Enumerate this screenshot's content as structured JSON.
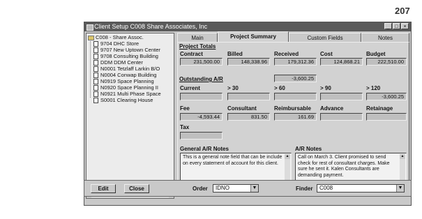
{
  "page_number": "207",
  "window": {
    "title": "Client Setup   C008   Share Associates, Inc",
    "controls": [
      "_",
      "□",
      "×"
    ]
  },
  "tree": {
    "root": "C008 - Share Assoc.",
    "items": [
      "9704  DHC Store",
      "9707  New Uptown Center",
      "9708  Consulting Building",
      "DDM  DDM Center",
      "N0001  Tetzlaff Larkin B/O",
      "N0004  Conwap Building",
      "N0919  Space Planning",
      "N0920  Space Planning II",
      "N0921  Multi Phase Space",
      "S0001  Clearing House"
    ]
  },
  "tabs": [
    "Main",
    "Project Summary",
    "Custom Fields",
    "Notes"
  ],
  "active_tab": "Project Summary",
  "totals": {
    "section": "Project Totals",
    "labels": [
      "Contract",
      "Billed",
      "Received",
      "Cost",
      "Budget"
    ],
    "values": [
      "231,500.00",
      "148,338.96",
      "179,312.36",
      "124,868.21",
      "222,510.00"
    ]
  },
  "ar": {
    "section": "Outstanding A/R",
    "total": "-3,600.25",
    "labels": [
      "Current",
      "> 30",
      "> 60",
      "> 90",
      "> 120"
    ],
    "values": [
      "",
      "",
      "",
      "",
      "-3,600.25"
    ]
  },
  "fees": {
    "labels": [
      "Fee",
      "Consultant",
      "Reimbursable",
      "Advance",
      "Retainage"
    ],
    "values": [
      "-4,593.44",
      "831.50",
      "161.69",
      "",
      ""
    ]
  },
  "tax": {
    "label": "Tax",
    "value": ""
  },
  "general_notes": {
    "title": "General A/R Notes",
    "text": "This is a general note field that can be include on every statement of account for this client."
  },
  "ar_notes": {
    "title": "A/R Notes",
    "text": "Call on March 3.  Client promised to send check for rest of consultant charges. Make sure he sent it.  Kalen Consultants are demanding payment."
  },
  "bottom": {
    "edit": "Edit",
    "close": "Close",
    "order_label": "Order",
    "order_value": "IDNO",
    "finder_label": "Finder",
    "finder_value": "C008"
  }
}
